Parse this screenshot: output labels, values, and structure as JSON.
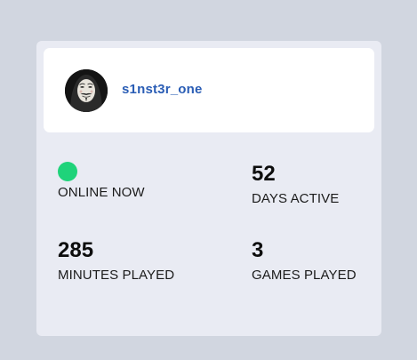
{
  "profile": {
    "username": "s1nst3r_one",
    "avatar_icon": "masked-face-avatar",
    "accent_color": "#2a5db5"
  },
  "status": {
    "label": "ONLINE NOW",
    "indicator_color": "#1fd37a",
    "indicator_icon": "status-dot-icon"
  },
  "stats": {
    "days_active": {
      "value": "52",
      "label": "DAYS ACTIVE"
    },
    "minutes_played": {
      "value": "285",
      "label": "MINUTES PLAYED"
    },
    "games_played": {
      "value": "3",
      "label": "GAMES PLAYED"
    }
  }
}
